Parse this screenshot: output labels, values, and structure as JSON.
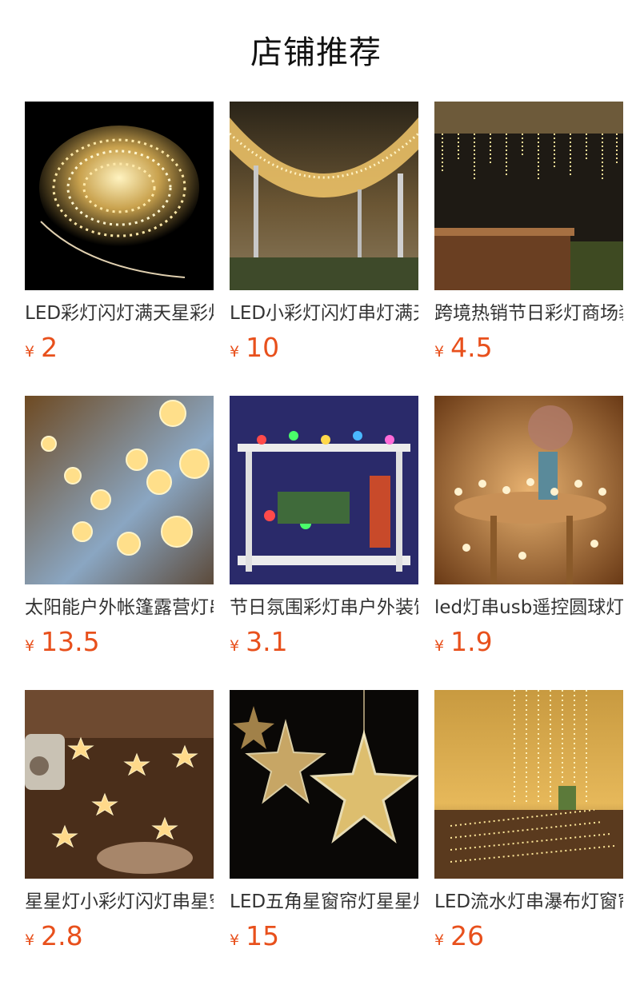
{
  "header": {
    "title": "店铺推荐"
  },
  "currency_symbol": "¥",
  "accent_color": "#e8501c",
  "products": [
    {
      "name": "LED彩灯闪灯满天星彩灯",
      "price": "2",
      "image": "fairy-light-coil-image"
    },
    {
      "name": "LED小彩灯闪灯串灯满天星",
      "price": "10",
      "image": "street-canopy-lights-image"
    },
    {
      "name": "跨境热销节日彩灯商场装饰",
      "price": "4.5",
      "image": "icicle-curtain-lights-image"
    },
    {
      "name": "太阳能户外帐篷露营灯串",
      "price": "13.5",
      "image": "crystal-ball-lights-image"
    },
    {
      "name": "节日氛围彩灯串户外装饰",
      "price": "3.1",
      "image": "colorful-shelf-lights-image"
    },
    {
      "name": "led灯串usb遥控圆球灯",
      "price": "1.9",
      "image": "round-ball-table-lights-image"
    },
    {
      "name": "星星灯小彩灯闪灯串星空",
      "price": "2.8",
      "image": "star-string-lights-image"
    },
    {
      "name": "LED五角星窗帘灯星星灯",
      "price": "15",
      "image": "star-curtain-lights-image"
    },
    {
      "name": "LED流水灯串瀑布灯窗帘",
      "price": "26",
      "image": "waterfall-curtain-lights-image"
    }
  ]
}
